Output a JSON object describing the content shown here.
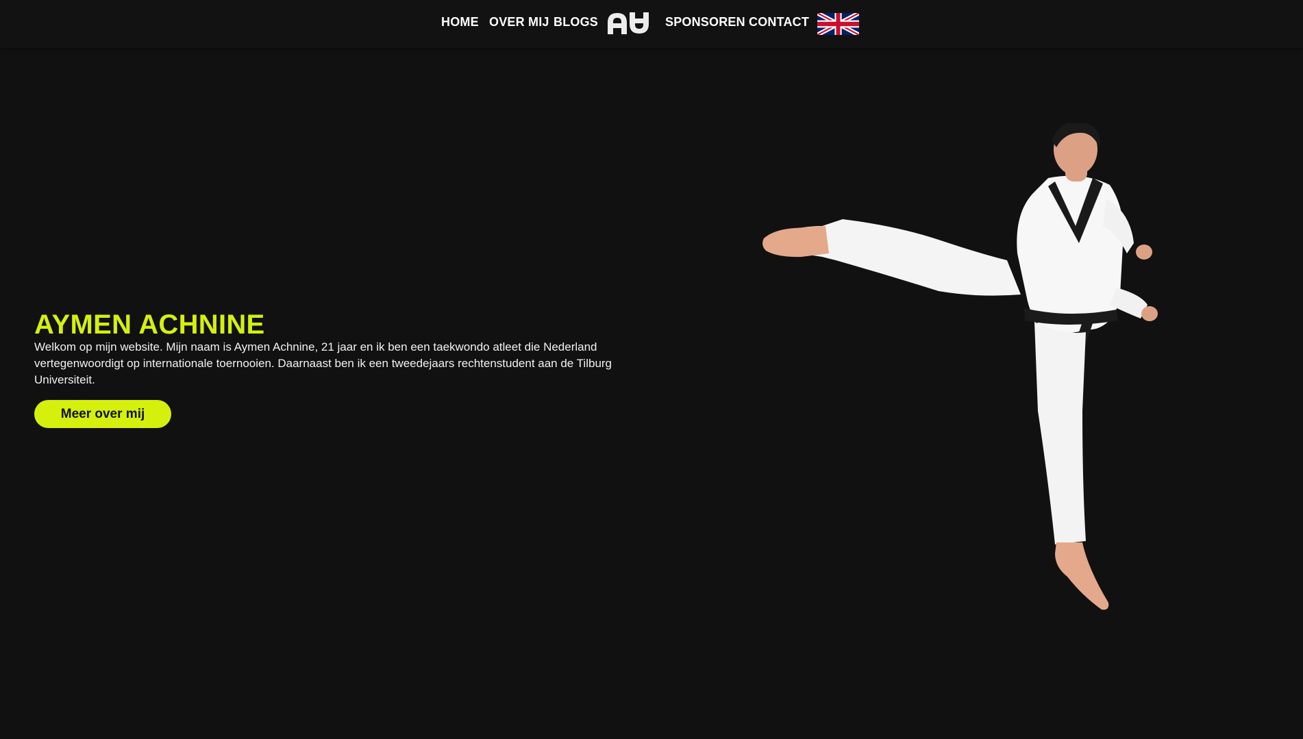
{
  "nav": {
    "items": [
      {
        "label": "HOME"
      },
      {
        "label": "OVER MIJ"
      },
      {
        "label": "BLOGS"
      },
      {
        "label": "SPONSOREN"
      },
      {
        "label": "CONTACT"
      }
    ],
    "logo_text": "AA",
    "language_icon": "uk-flag-icon"
  },
  "hero": {
    "title": "AYMEN ACHNINE",
    "text": "Welkom op mijn website. Mijn naam is Aymen Achnine, 21 jaar en ik ben een taekwondo atleet die Nederland vertegenwoordigt op internationale toernooien. Daarnaast ben ik een tweedejaars rechtenstudent aan de Tilburg Universiteit.",
    "button_label": "Meer over mij",
    "image": "taekwondo-athlete-kick-photo"
  },
  "colors": {
    "background": "#111111",
    "accent": "#d4f00c",
    "text": "#ffffff",
    "flag_blue": "#012169",
    "flag_red": "#C8102E"
  }
}
